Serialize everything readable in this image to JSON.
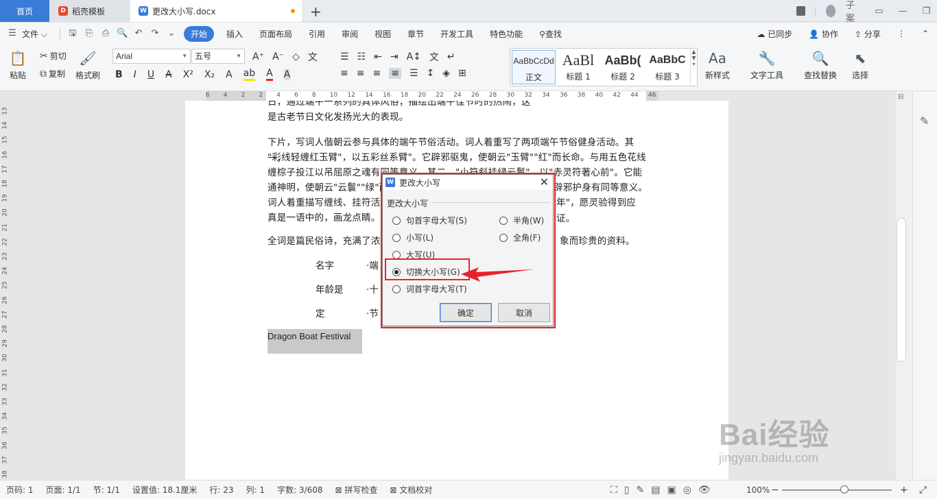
{
  "tabs": {
    "home": "首页",
    "template": "稻壳模板",
    "document": "更改大小写.docx",
    "new_tab": "+"
  },
  "window": {
    "badge": "1",
    "user": "子案"
  },
  "menu": {
    "file": "文件",
    "items": [
      "开始",
      "插入",
      "页面布局",
      "引用",
      "审阅",
      "视图",
      "章节",
      "开发工具",
      "特色功能",
      "查找"
    ],
    "synced": "已同步",
    "collab": "协作",
    "share": "分享"
  },
  "ribbon": {
    "paste": "粘贴",
    "cut": "剪切",
    "copy": "复制",
    "format_painter": "格式刷",
    "font_name": "Arial",
    "font_size": "五号",
    "styles": [
      {
        "preview": "AaBbCcDd",
        "label": "正文"
      },
      {
        "preview": "AaBl",
        "label": "标题 1"
      },
      {
        "preview": "AaBb(",
        "label": "标题 2"
      },
      {
        "preview": "AaBbC",
        "label": "标题 3"
      }
    ],
    "new_style": "新样式",
    "text_tools": "文字工具",
    "find_replace": "查找替换",
    "select": "选择"
  },
  "ruler": {
    "h_ticks": [
      "6",
      "4",
      "2",
      "2",
      "4",
      "6",
      "8",
      "10",
      "12",
      "14",
      "16",
      "18",
      "20",
      "22",
      "24",
      "26",
      "28",
      "30",
      "32",
      "34",
      "36",
      "38",
      "40",
      "42",
      "44",
      "46"
    ],
    "v_ticks": [
      "13",
      "14",
      "15",
      "16",
      "17",
      "18",
      "19",
      "20",
      "21",
      "22",
      "23",
      "24",
      "25",
      "26",
      "27",
      "28",
      "29",
      "30",
      "31",
      "32",
      "33",
      "34",
      "35",
      "36",
      "37",
      "38"
    ]
  },
  "document": {
    "line_top_partial": "日，通过端午一系列的具体风俗，描绘出端午佳节时的热闹，这",
    "para1_line2": "是古老节日文化发扬光大的表现。",
    "para2": [
      "下片，写词人偕朝云参与具体的端午节俗活动。词人着重写了两项端午节俗健身活动。其一，",
      "\"彩线轻缠红玉臂\"，以五彩丝系臂\"。它辟邪驱鬼，使朝云\"玉臂\"\"红\"而长命。与用五色花线",
      "缠棕子投江以吊屈原之魂有同等意义。其二，\"小符斜挂绿云鬟\"，以\"赤灵符著心前\"。它能",
      "通神明，使朝云\"云鬟\"\"绿\"而",
      "词人着重描写缠线、挂符活",
      "真是一语中的，画龙点睛。"
    ],
    "para2_right": [
      "辟邪护身有同等意义。",
      "年\"，愿灵验得到应证。"
    ],
    "para3_left": "全词是篇民俗诗，充满了浓",
    "para3_right": "象而珍贵的资料。",
    "table": [
      {
        "label": "名字",
        "value": "·端"
      },
      {
        "label": "年龄是",
        "value": "·十"
      },
      {
        "label": "定",
        "value": "·节"
      }
    ],
    "selected_text": "Dragon Boat Festival"
  },
  "dialog": {
    "title": "更改大小写",
    "group": "更改大小写",
    "options_left": [
      "句首字母大写(S)",
      "小写(L)",
      "大写(U)",
      "切换大小写(G)",
      "词首字母大写(T)"
    ],
    "options_right": [
      "半角(W)",
      "全角(F)"
    ],
    "selected": "切换大小写(G)",
    "ok": "确定",
    "cancel": "取消"
  },
  "status": {
    "page_code": "页码: 1",
    "page": "页面: 1/1",
    "section": "节: 1/1",
    "setting": "设置值: 18.1厘米",
    "row": "行: 23",
    "col": "列: 1",
    "words": "字数: 3/608",
    "spell": "拼写检查",
    "proof": "文档校对",
    "zoom": "100%"
  },
  "watermark": {
    "brand": "Bai经验",
    "url": "jingyan.baidu.com"
  },
  "colors": {
    "accent": "#3b7bd8",
    "highlight": "#e8232b",
    "selection": "#c9c9c9"
  }
}
